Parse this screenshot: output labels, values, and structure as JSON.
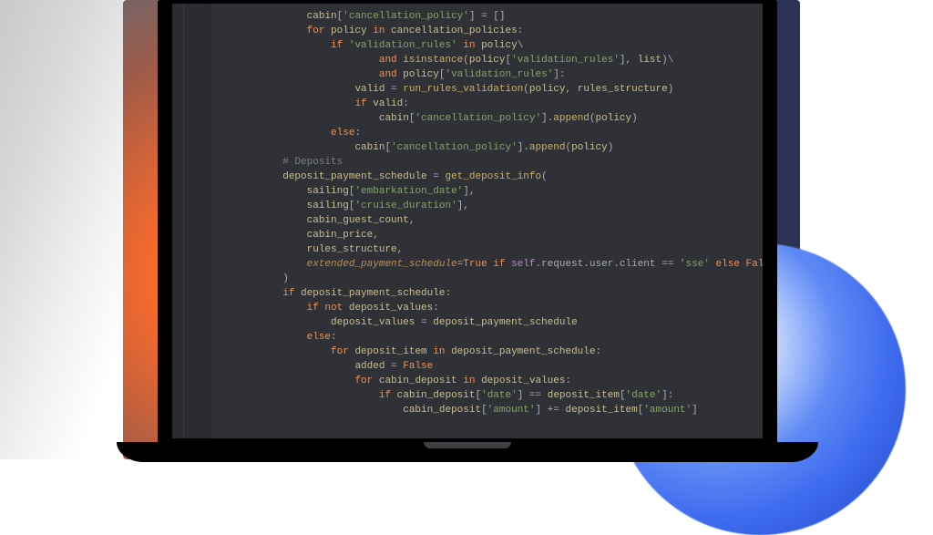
{
  "device": "laptop-mockup",
  "editor": {
    "theme": "dark",
    "language": "python",
    "code_lines": [
      {
        "indent": 4,
        "tokens": [
          [
            "n",
            "cabin"
          ],
          [
            "p",
            "["
          ],
          [
            "s",
            "'cancellation_policy'"
          ],
          [
            "p",
            "] = []"
          ]
        ]
      },
      {
        "indent": 4,
        "tokens": [
          [
            "k",
            "for "
          ],
          [
            "n",
            "policy"
          ],
          [
            "k",
            " in "
          ],
          [
            "n",
            "cancellation_policies"
          ],
          [
            "p",
            ":"
          ]
        ]
      },
      {
        "indent": 5,
        "tokens": [
          [
            "k",
            "if "
          ],
          [
            "s",
            "'validation_rules'"
          ],
          [
            "k",
            " in "
          ],
          [
            "n",
            "policy"
          ],
          [
            "p",
            "\\"
          ]
        ]
      },
      {
        "indent": 7,
        "tokens": [
          [
            "k",
            "and "
          ],
          [
            "f",
            "isinstance"
          ],
          [
            "p",
            "("
          ],
          [
            "n",
            "policy"
          ],
          [
            "p",
            "["
          ],
          [
            "s",
            "'validation_rules'"
          ],
          [
            "p",
            "], "
          ],
          [
            "n",
            "list"
          ],
          [
            "p",
            ")\\"
          ]
        ]
      },
      {
        "indent": 7,
        "tokens": [
          [
            "k",
            "and "
          ],
          [
            "n",
            "policy"
          ],
          [
            "p",
            "["
          ],
          [
            "s",
            "'validation_rules'"
          ],
          [
            "p",
            "]:"
          ]
        ]
      },
      {
        "indent": 6,
        "tokens": [
          [
            "n",
            "valid"
          ],
          [
            "p",
            " = "
          ],
          [
            "f",
            "run_rules_validation"
          ],
          [
            "p",
            "("
          ],
          [
            "n",
            "policy"
          ],
          [
            "p",
            ", "
          ],
          [
            "n",
            "rules_structure"
          ],
          [
            "p",
            ")"
          ]
        ]
      },
      {
        "indent": 6,
        "tokens": [
          [
            "k",
            "if "
          ],
          [
            "n",
            "valid"
          ],
          [
            "p",
            ":"
          ]
        ]
      },
      {
        "indent": 7,
        "tokens": [
          [
            "n",
            "cabin"
          ],
          [
            "p",
            "["
          ],
          [
            "s",
            "'cancellation_policy'"
          ],
          [
            "p",
            "]."
          ],
          [
            "f",
            "append"
          ],
          [
            "p",
            "("
          ],
          [
            "n",
            "policy"
          ],
          [
            "p",
            ")"
          ]
        ]
      },
      {
        "indent": 5,
        "tokens": [
          [
            "k",
            "else"
          ],
          [
            "p",
            ":"
          ]
        ]
      },
      {
        "indent": 6,
        "tokens": [
          [
            "n",
            "cabin"
          ],
          [
            "p",
            "["
          ],
          [
            "s",
            "'cancellation_policy'"
          ],
          [
            "p",
            "]."
          ],
          [
            "f",
            "append"
          ],
          [
            "p",
            "("
          ],
          [
            "n",
            "policy"
          ],
          [
            "p",
            ")"
          ]
        ]
      },
      {
        "indent": 0,
        "tokens": []
      },
      {
        "indent": 3,
        "tokens": [
          [
            "c",
            "# Deposits"
          ]
        ]
      },
      {
        "indent": 3,
        "tokens": [
          [
            "n",
            "deposit_payment_schedule"
          ],
          [
            "p",
            " = "
          ],
          [
            "f",
            "get_deposit_info"
          ],
          [
            "p",
            "("
          ]
        ]
      },
      {
        "indent": 4,
        "tokens": [
          [
            "n",
            "sailing"
          ],
          [
            "p",
            "["
          ],
          [
            "s",
            "'embarkation_date'"
          ],
          [
            "p",
            "],"
          ]
        ]
      },
      {
        "indent": 4,
        "tokens": [
          [
            "n",
            "sailing"
          ],
          [
            "p",
            "["
          ],
          [
            "s",
            "'cruise_duration'"
          ],
          [
            "p",
            "],"
          ]
        ]
      },
      {
        "indent": 4,
        "tokens": [
          [
            "n",
            "cabin_guest_count"
          ],
          [
            "p",
            ","
          ]
        ]
      },
      {
        "indent": 4,
        "tokens": [
          [
            "n",
            "cabin_price"
          ],
          [
            "p",
            ","
          ]
        ]
      },
      {
        "indent": 4,
        "tokens": [
          [
            "n",
            "rules_structure"
          ],
          [
            "p",
            ","
          ]
        ]
      },
      {
        "indent": 4,
        "tokens": [
          [
            "b",
            "extended_payment_schedule"
          ],
          [
            "p",
            "="
          ],
          [
            "k",
            "True"
          ],
          [
            "k",
            " if "
          ],
          [
            "sp",
            "self"
          ],
          [
            "p",
            ".request.user.client == "
          ],
          [
            "s",
            "'sse'"
          ],
          [
            "k",
            " else "
          ],
          [
            "k",
            "False"
          ],
          [
            "p",
            ","
          ]
        ]
      },
      {
        "indent": 3,
        "tokens": [
          [
            "p",
            ")"
          ]
        ]
      },
      {
        "indent": 3,
        "tokens": [
          [
            "k",
            "if "
          ],
          [
            "n",
            "deposit_payment_schedule"
          ],
          [
            "p",
            ":"
          ]
        ]
      },
      {
        "indent": 4,
        "tokens": [
          [
            "k",
            "if not "
          ],
          [
            "n",
            "deposit_values"
          ],
          [
            "p",
            ":"
          ]
        ]
      },
      {
        "indent": 5,
        "tokens": [
          [
            "n",
            "deposit_values"
          ],
          [
            "p",
            " = "
          ],
          [
            "n",
            "deposit_payment_schedule"
          ]
        ]
      },
      {
        "indent": 4,
        "tokens": [
          [
            "k",
            "else"
          ],
          [
            "p",
            ":"
          ]
        ]
      },
      {
        "indent": 5,
        "tokens": [
          [
            "k",
            "for "
          ],
          [
            "n",
            "deposit_item"
          ],
          [
            "k",
            " in "
          ],
          [
            "n",
            "deposit_payment_schedule"
          ],
          [
            "p",
            ":"
          ]
        ]
      },
      {
        "indent": 6,
        "tokens": [
          [
            "n",
            "added"
          ],
          [
            "p",
            " = "
          ],
          [
            "k",
            "False"
          ]
        ]
      },
      {
        "indent": 6,
        "tokens": [
          [
            "k",
            "for "
          ],
          [
            "n",
            "cabin_deposit"
          ],
          [
            "k",
            " in "
          ],
          [
            "n",
            "deposit_values"
          ],
          [
            "p",
            ":"
          ]
        ]
      },
      {
        "indent": 7,
        "tokens": [
          [
            "k",
            "if "
          ],
          [
            "n",
            "cabin_deposit"
          ],
          [
            "p",
            "["
          ],
          [
            "s",
            "'date'"
          ],
          [
            "p",
            "] == "
          ],
          [
            "n",
            "deposit_item"
          ],
          [
            "p",
            "["
          ],
          [
            "s",
            "'date'"
          ],
          [
            "p",
            "]:"
          ]
        ]
      },
      {
        "indent": 8,
        "tokens": [
          [
            "n",
            "cabin_deposit"
          ],
          [
            "p",
            "["
          ],
          [
            "s",
            "'amount'"
          ],
          [
            "p",
            "] += "
          ],
          [
            "n",
            "deposit_item"
          ],
          [
            "p",
            "["
          ],
          [
            "s",
            "'amount'"
          ],
          [
            "p",
            "]"
          ]
        ]
      }
    ]
  }
}
